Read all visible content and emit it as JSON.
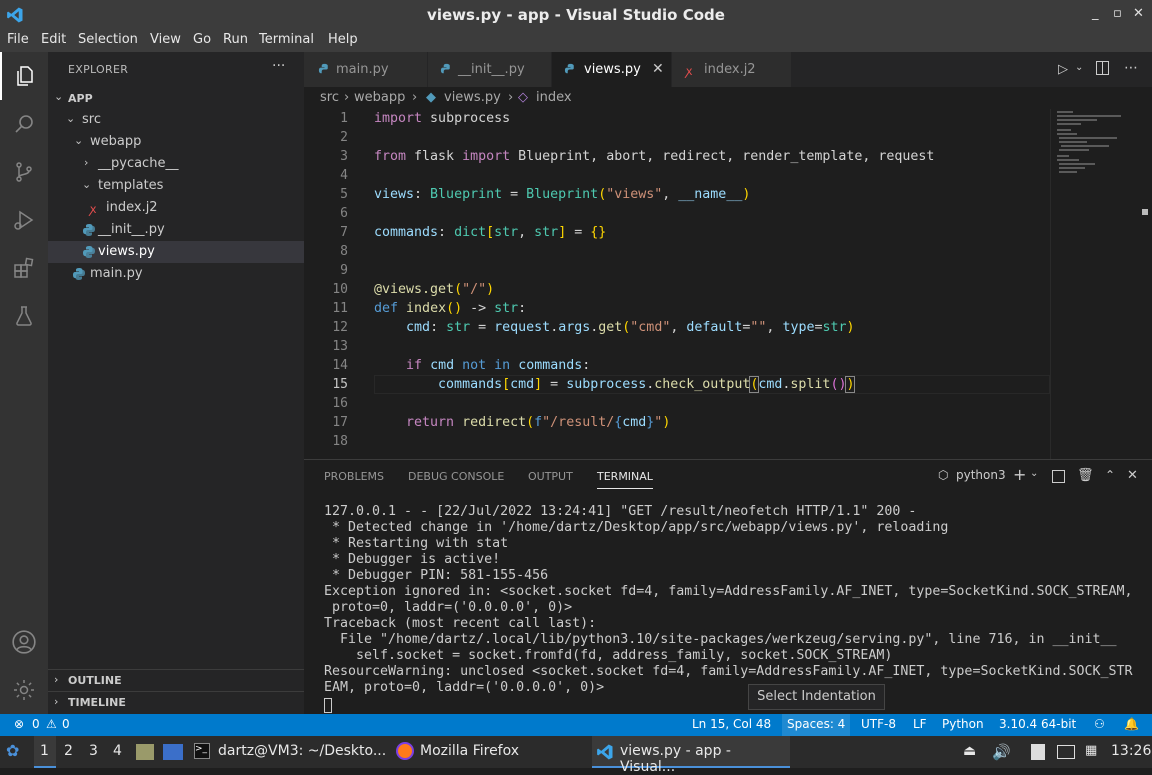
{
  "window": {
    "title": "views.py - app - Visual Studio Code",
    "controls": {
      "minimize": "_",
      "restore": "▫",
      "close": "✕"
    }
  },
  "menu": [
    "File",
    "Edit",
    "Selection",
    "View",
    "Go",
    "Run",
    "Terminal",
    "Help"
  ],
  "sidebar": {
    "header": "EXPLORER",
    "more": "···",
    "root": "APP",
    "tree": [
      {
        "label": "src"
      },
      {
        "label": "webapp"
      },
      {
        "label": "__pycache__"
      },
      {
        "label": "templates"
      },
      {
        "label": "index.j2"
      },
      {
        "label": "__init__.py"
      },
      {
        "label": "views.py"
      },
      {
        "label": "main.py"
      }
    ],
    "outline": "OUTLINE",
    "timeline": "TIMELINE"
  },
  "tabs": [
    {
      "label": "main.py"
    },
    {
      "label": "__init__.py"
    },
    {
      "label": "views.py"
    },
    {
      "label": "index.j2"
    }
  ],
  "breadcrumb": {
    "p1": "src",
    "p2": "webapp",
    "p3": "views.py",
    "p4": "index"
  },
  "editor": {
    "line_numbers": [
      "1",
      "2",
      "3",
      "4",
      "5",
      "6",
      "7",
      "8",
      "9",
      "10",
      "11",
      "12",
      "13",
      "14",
      "15",
      "16",
      "17",
      "18"
    ],
    "current_line": "15"
  },
  "panel": {
    "tabs": [
      "PROBLEMS",
      "DEBUG CONSOLE",
      "OUTPUT",
      "TERMINAL"
    ],
    "shell": "python3",
    "terminal_lines": [
      "127.0.0.1 - - [22/Jul/2022 13:24:41] \"GET /result/neofetch HTTP/1.1\" 200 -",
      " * Detected change in '/home/dartz/Desktop/app/src/webapp/views.py', reloading",
      " * Restarting with stat",
      " * Debugger is active!",
      " * Debugger PIN: 581-155-456",
      "Exception ignored in: <socket.socket fd=4, family=AddressFamily.AF_INET, type=SocketKind.SOCK_STREAM,",
      " proto=0, laddr=('0.0.0.0', 0)>",
      "Traceback (most recent call last):",
      "  File \"/home/dartz/.local/lib/python3.10/site-packages/werkzeug/serving.py\", line 716, in __init__",
      "    self.socket = socket.fromfd(fd, address_family, socket.SOCK_STREAM)",
      "ResourceWarning: unclosed <socket.socket fd=4, family=AddressFamily.AF_INET, type=SocketKind.SOCK_STR",
      "EAM, proto=0, laddr=('0.0.0.0', 0)>"
    ],
    "tooltip": "Select Indentation"
  },
  "status": {
    "errors": "0",
    "warnings": "0",
    "position": "Ln 15, Col 48",
    "spaces": "Spaces: 4",
    "encoding": "UTF-8",
    "eol": "LF",
    "language": "Python",
    "interpreter": "3.10.4 64-bit"
  },
  "taskbar": {
    "workspaces": [
      "1",
      "2",
      "3",
      "4"
    ],
    "terminal": "dartz@VM3: ~/Deskto...",
    "firefox": "Mozilla Firefox",
    "vscode": "views.py - app - Visual...",
    "clock": "13:26"
  },
  "colors": {
    "accent": "#007acc",
    "titlebar": "#3c3c3c",
    "editor_bg": "#1e1e1e"
  }
}
